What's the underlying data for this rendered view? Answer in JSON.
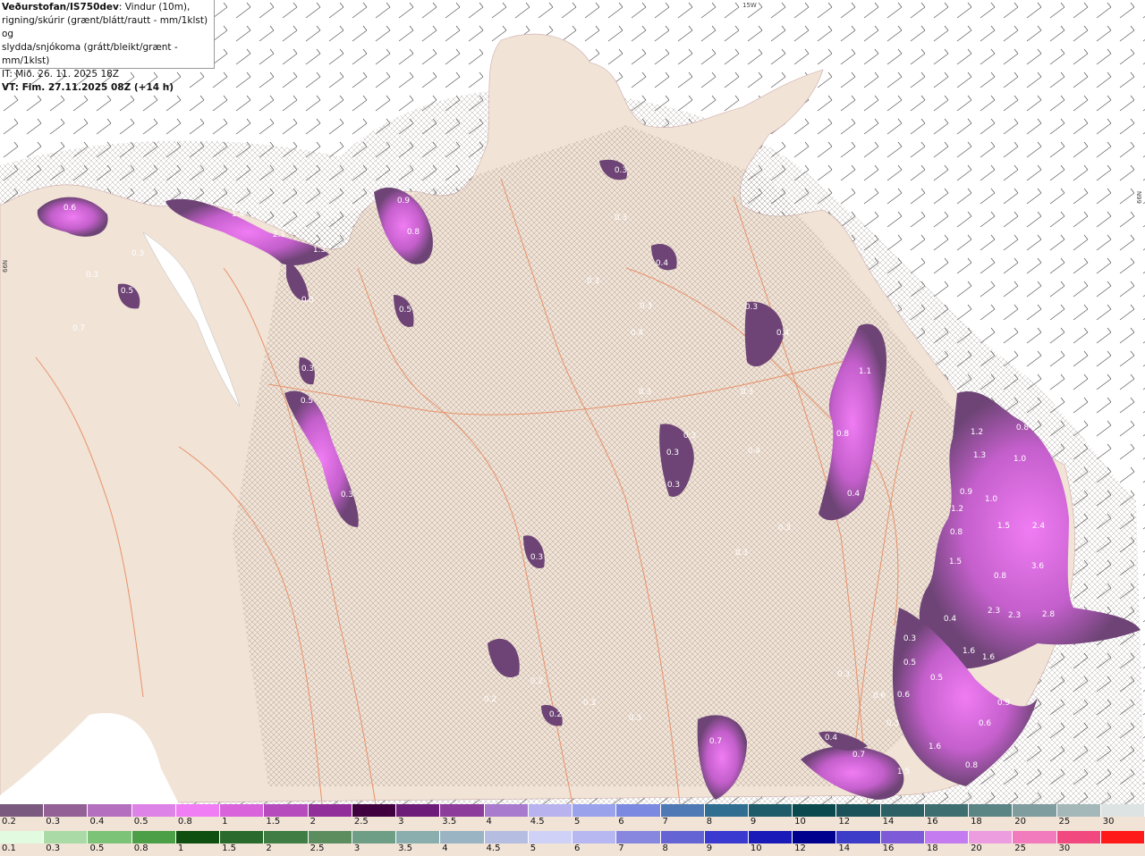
{
  "info": {
    "title": "Veðurstofan/IS750dev",
    "line1_rest": ": Vindur (10m),",
    "line2": "rigning/skúrir (grænt/blátt/rautt - mm/1klst) og",
    "line3": "slydda/snjókoma (grátt/bleikt/grænt - mm/1klst)",
    "line4": "IT: Mið. 26. 11. 2025 18Z",
    "line5": "VT: Fim. 27.11.2025 08Z (+14 h)"
  },
  "grid_labels": {
    "lon": "15W",
    "lat_left": "66N",
    "lat_right": "66N"
  },
  "precip_labels": [
    "0.6",
    "0.3",
    "0.3",
    "0.5",
    "0.7",
    "1.4",
    "2.1",
    "1.3",
    "0.3",
    "0.3",
    "0.5",
    "0.9",
    "0.8",
    "0.5",
    "0.3",
    "0.3",
    "0.3",
    "0.3",
    "0.3",
    "0.4",
    "0.3",
    "0.3",
    "0.3",
    "0.3",
    "0.4",
    "0.3",
    "0.3",
    "0.4",
    "0.3",
    "0.2",
    "0.3",
    "1.1",
    "0.8",
    "0.4",
    "1.2",
    "1.3",
    "0.8",
    "1.0",
    "0.9",
    "1.0",
    "1.2",
    "1.5",
    "2.4",
    "0.8",
    "1.5",
    "0.8",
    "3.6",
    "2.3",
    "2.3",
    "2.8",
    "0.4",
    "1.6",
    "1.6",
    "0.5",
    "0.5",
    "0.6",
    "0.6",
    "0.9",
    "0.6",
    "0.4",
    "0.7",
    "1.5",
    "1.6",
    "0.8",
    "0.3",
    "0.4",
    "0.3",
    "0.3",
    "0.2",
    "0.3",
    "0.2",
    "0.7",
    "0.3",
    "0.3"
  ],
  "legend_snow": {
    "colors": [
      "#7a5a7e",
      "#936196",
      "#b56fbf",
      "#dd82e6",
      "#f17df5",
      "#d863da",
      "#b64bbd",
      "#922e99",
      "#40003f",
      "#6e1c79",
      "#8c3d9b",
      "#a97bcf",
      "#b8b3ef",
      "#9aa2ec",
      "#7b8ae0",
      "#4e79b5",
      "#2f6e90",
      "#1e5c6a",
      "#0a4a4f",
      "#1b5259",
      "#2d6064",
      "#3e6e70",
      "#5b8485",
      "#7f9d9f",
      "#a4b8b9",
      "#dde3e3"
    ],
    "labels": [
      "0.2",
      "0.3",
      "0.4",
      "0.5",
      "0.8",
      "1",
      "1.5",
      "2",
      "2.5",
      "3",
      "3.5",
      "4",
      "4.5",
      "5",
      "6",
      "7",
      "8",
      "9",
      "10",
      "12",
      "14",
      "16",
      "18",
      "20",
      "25",
      "30"
    ]
  },
  "legend_rain": {
    "colors": [
      "#e2fbe0",
      "#aadba6",
      "#7cc277",
      "#4c9e47",
      "#0f4f0f",
      "#2a6a2c",
      "#3f7d45",
      "#5c8d5f",
      "#6e9e86",
      "#8aaeae",
      "#9ab4c4",
      "#b5bde0",
      "#cfd1f7",
      "#b7b7f2",
      "#8787e0",
      "#6464d5",
      "#3a3ad0",
      "#1a1ab8",
      "#00008e",
      "#3d3cc8",
      "#7c5ad8",
      "#c37bef",
      "#ec9de0",
      "#f27bbd",
      "#f14880",
      "#ff1a1a"
    ],
    "labels": [
      "0.1",
      "0.3",
      "0.5",
      "0.8",
      "1",
      "1.5",
      "2",
      "2.5",
      "3",
      "3.5",
      "4",
      "4.5",
      "5",
      "6",
      "7",
      "8",
      "9",
      "10",
      "12",
      "14",
      "16",
      "18",
      "20",
      "25",
      "30"
    ]
  }
}
